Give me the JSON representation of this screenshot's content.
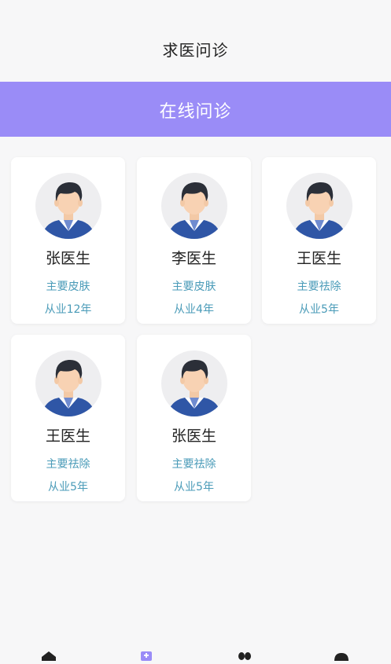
{
  "header": {
    "title": "求医问诊"
  },
  "banner": {
    "label": "在线问诊"
  },
  "doctors": [
    {
      "name": "张医生",
      "specialty": "主要皮肤",
      "experience": "从业12年"
    },
    {
      "name": "李医生",
      "specialty": "主要皮肤",
      "experience": "从业4年"
    },
    {
      "name": "王医生",
      "specialty": "主要祛除",
      "experience": "从业5年"
    },
    {
      "name": "王医生",
      "specialty": "主要祛除",
      "experience": "从业5年"
    },
    {
      "name": "张医生",
      "specialty": "主要祛除",
      "experience": "从业5年"
    }
  ],
  "tabbar": {
    "icons": [
      "home-icon",
      "consult-icon",
      "community-icon",
      "profile-icon"
    ],
    "active_color": "#9a8cf7",
    "inactive_color": "#222222"
  },
  "colors": {
    "banner": "#9a8cf7",
    "accent_text": "#4a9bb8"
  }
}
